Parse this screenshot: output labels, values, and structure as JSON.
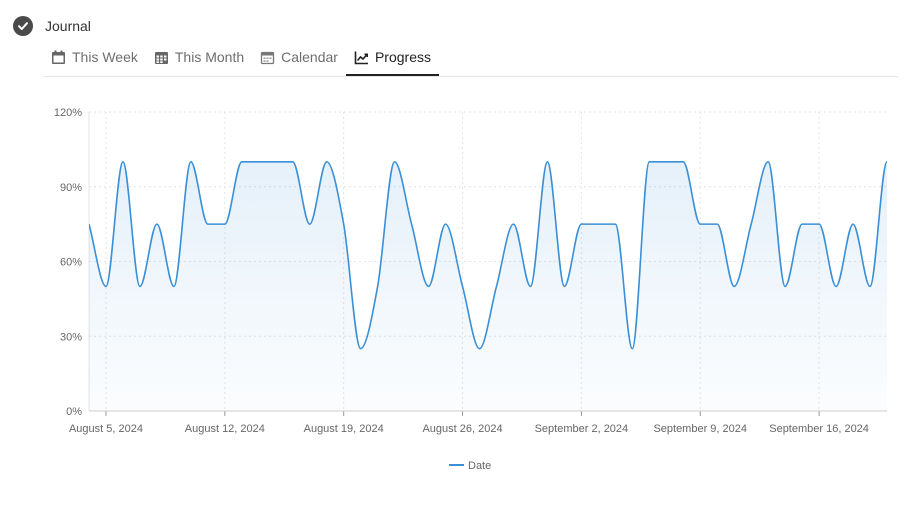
{
  "header": {
    "title": "Journal",
    "icon": "check-circle-icon"
  },
  "tabs": [
    {
      "label": "This Week",
      "icon": "calendar-icon",
      "active": false
    },
    {
      "label": "This Month",
      "icon": "calendar-grid-icon",
      "active": false
    },
    {
      "label": "Calendar",
      "icon": "calendar-outline-icon",
      "active": false
    },
    {
      "label": "Progress",
      "icon": "trend-icon",
      "active": true
    }
  ],
  "chart_data": {
    "type": "area",
    "series": [
      {
        "name": "Date",
        "color": "#3a8fd6",
        "x": [
          "2024-08-04",
          "2024-08-05",
          "2024-08-06",
          "2024-08-07",
          "2024-08-08",
          "2024-08-09",
          "2024-08-10",
          "2024-08-11",
          "2024-08-12",
          "2024-08-13",
          "2024-08-14",
          "2024-08-15",
          "2024-08-16",
          "2024-08-17",
          "2024-08-18",
          "2024-08-19",
          "2024-08-20",
          "2024-08-21",
          "2024-08-22",
          "2024-08-23",
          "2024-08-24",
          "2024-08-25",
          "2024-08-26",
          "2024-08-27",
          "2024-08-28",
          "2024-08-29",
          "2024-08-30",
          "2024-08-31",
          "2024-09-01",
          "2024-09-02",
          "2024-09-03",
          "2024-09-04",
          "2024-09-05",
          "2024-09-06",
          "2024-09-07",
          "2024-09-08",
          "2024-09-09",
          "2024-09-10",
          "2024-09-11",
          "2024-09-12",
          "2024-09-13",
          "2024-09-14",
          "2024-09-15",
          "2024-09-16",
          "2024-09-17",
          "2024-09-18",
          "2024-09-19",
          "2024-09-20",
          "2024-09-21"
        ],
        "values": [
          75,
          50,
          100,
          50,
          75,
          50,
          100,
          75,
          75,
          100,
          100,
          100,
          100,
          75,
          100,
          75,
          25,
          50,
          100,
          75,
          50,
          75,
          50,
          25,
          50,
          75,
          50,
          100,
          50,
          75,
          75,
          75,
          25,
          100,
          100,
          100,
          75,
          75,
          50,
          75,
          100,
          50,
          75,
          75,
          50,
          75,
          50,
          100,
          100
        ]
      }
    ],
    "xticks": [
      "August 5, 2024",
      "August 12, 2024",
      "August 19, 2024",
      "August 26, 2024",
      "September 2, 2024",
      "September 9, 2024",
      "September 16, 2024"
    ],
    "yticks": [
      "0%",
      "30%",
      "60%",
      "90%",
      "120%"
    ],
    "ylim": [
      0,
      120
    ],
    "xlim": [
      "2024-08-04",
      "2024-09-20"
    ],
    "grid": true,
    "legend": "bottom"
  }
}
